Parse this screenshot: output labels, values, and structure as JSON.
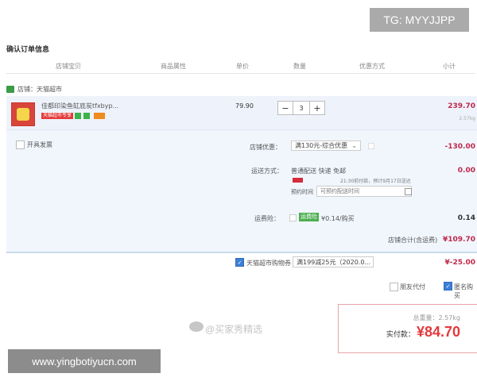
{
  "badges": {
    "tg": "TG: MYYJJPP",
    "site": "www.yingbotiyucn.com"
  },
  "page_title": "确认订单信息",
  "columns": [
    "店铺宝贝",
    "商品属性",
    "单价",
    "数量",
    "优惠方式",
    "小计"
  ],
  "store": {
    "name": "店铺：天猫超市"
  },
  "item": {
    "name": "佳都印染鱼缸底炭tfxbyp...",
    "tag": "天猫超市专享",
    "unit_price": "79.90",
    "quantity": "3",
    "minus": "−",
    "plus": "+",
    "subtotal": "239.70",
    "weight": "2.57kg"
  },
  "options": {
    "invoice_label": "开具发票",
    "store_discount_label": "店铺优惠：",
    "store_discount_value": "满130元-综合优惠",
    "store_discount_amount": "-130.00",
    "shipping_label": "运送方式：",
    "shipping_value": "普通配送 快递 免邮",
    "shipping_note": "21:30前付款，预计9月17日送达",
    "shipping_amount": "0.00",
    "time_label": "预约时间",
    "time_placeholder": "可预约配送时间",
    "jd_label": "运费险：",
    "jd_badge": "运费险",
    "jd_value": "¥0.14/购买",
    "jd_amount": "0.14",
    "store_total_label": "店铺合计(含运费)",
    "store_total": "¥109.70"
  },
  "coupon": {
    "label": "天猫超市购物券",
    "value": "满199减25元（2020.0...",
    "amount": "¥-25.00"
  },
  "footer_options": {
    "pay_for_others": "朋友代付",
    "anonymous": "匿名购买"
  },
  "payment": {
    "weight_label": "总重量：",
    "weight_value": "2.57kg",
    "pay_label": "实付款：",
    "pay_amount": "¥84.70"
  },
  "watermark": "@买家秀精选",
  "colors": {
    "accent_red": "#c0284a",
    "panel_bg": "#f1f6fd",
    "checkbox_blue": "#3d7fd6"
  }
}
